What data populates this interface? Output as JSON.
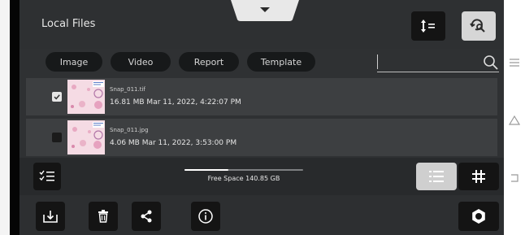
{
  "header": {
    "title": "Local Files"
  },
  "filters": [
    {
      "label": "Image"
    },
    {
      "label": "Video"
    },
    {
      "label": "Report"
    },
    {
      "label": "Template"
    }
  ],
  "search": {
    "value": "",
    "placeholder": ""
  },
  "files": [
    {
      "name": "Snap_011.tif",
      "meta": "16.81 MB Mar 11, 2022, 4:22:07 PM",
      "checked": true
    },
    {
      "name": "Snap_011.jpg",
      "meta": "4.06 MB Mar 11, 2022, 3:53:00 PM",
      "checked": false
    }
  ],
  "storage": {
    "label": "Free Space 140.85 GB",
    "used_fraction": 0.37
  },
  "view": {
    "mode": "list"
  },
  "colors": {
    "app_background": "#2f3133",
    "row_background": "#3d3f41",
    "chip_background": "#17191a",
    "active_button": "#d6d6d6",
    "button_background": "#141414"
  },
  "icons": {
    "pull_tab": "chevron-down-icon",
    "sort": "sort-icon",
    "filter": "filter-search-icon",
    "search": "search-icon",
    "select_all": "checklist-icon",
    "list_view": "list-view-icon",
    "grid_view": "grid-view-icon",
    "export": "export-icon",
    "delete": "trash-icon",
    "share": "share-icon",
    "info": "info-icon",
    "settings": "settings-icon",
    "nav_menu": "menu-icon",
    "nav_home": "home-icon",
    "nav_back": "back-icon"
  }
}
